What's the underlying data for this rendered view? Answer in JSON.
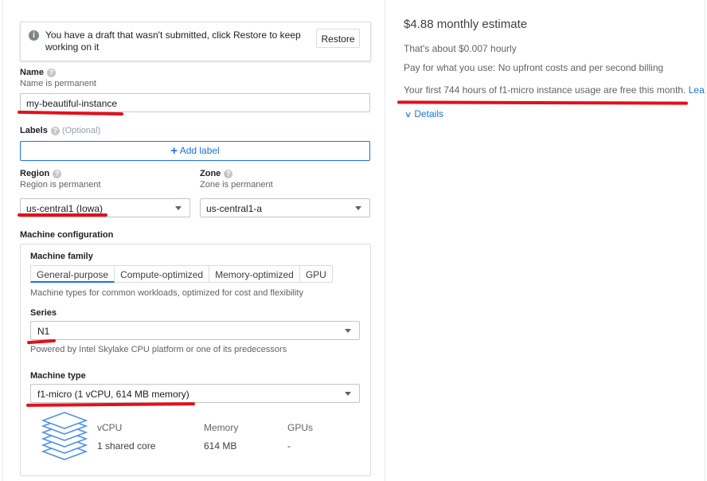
{
  "draft_banner": {
    "message": "You have a draft that wasn't submitted, click Restore to keep working on it",
    "restore_label": "Restore"
  },
  "name": {
    "label": "Name",
    "hint": "Name is permanent",
    "value": "my-beautiful-instance"
  },
  "labels": {
    "label": "Labels",
    "optional": "(Optional)",
    "add_button": "Add label"
  },
  "region": {
    "label": "Region",
    "hint": "Region is permanent",
    "value": "us-central1 (Iowa)"
  },
  "zone": {
    "label": "Zone",
    "hint": "Zone is permanent",
    "value": "us-central1-a"
  },
  "machine": {
    "section_label": "Machine configuration",
    "family_label": "Machine family",
    "tabs": [
      "General-purpose",
      "Compute-optimized",
      "Memory-optimized",
      "GPU"
    ],
    "family_desc": "Machine types for common workloads, optimized for cost and flexibility",
    "series_label": "Series",
    "series_value": "N1",
    "series_desc": "Powered by Intel Skylake CPU platform or one of its predecessors",
    "type_label": "Machine type",
    "type_value": "f1-micro (1 vCPU, 614 MB memory)",
    "specs": {
      "vcpu_header": "vCPU",
      "vcpu_value": "1 shared core",
      "memory_header": "Memory",
      "memory_value": "614 MB",
      "gpus_header": "GPUs",
      "gpus_value": "-"
    }
  },
  "estimate": {
    "title": "$4.88 monthly estimate",
    "hourly": "That's about $0.007 hourly",
    "billing": "Pay for what you use: No upfront costs and per second billing",
    "free_tier": "Your first 744 hours of f1-micro instance usage are free this month.",
    "learn_more": "Lear",
    "details": "Details"
  },
  "colors": {
    "accent": "#1a73e8",
    "annotation_red": "#e3101b"
  }
}
